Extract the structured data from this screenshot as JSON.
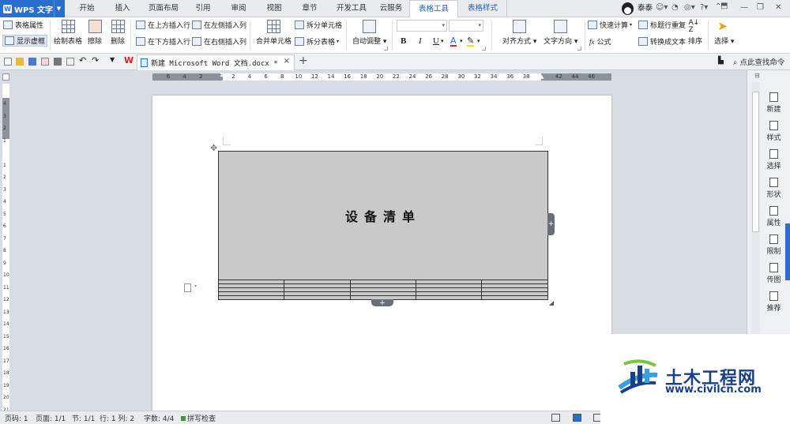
{
  "app": {
    "logo_text": "WPS 文字"
  },
  "menu_tabs": [
    "开始",
    "插入",
    "页面布局",
    "引用",
    "审阅",
    "视图",
    "章节",
    "开发工具",
    "云服务",
    "表格工具",
    "表格样式"
  ],
  "user": {
    "name": "泰泰"
  },
  "ribbon": {
    "table_props": "表格属性",
    "show_gridlines": "显示虚框",
    "draw_table": "绘制表格",
    "erase": "擦除",
    "delete": "删除",
    "insert_above": "在上方插入行",
    "insert_below": "在下方插入行",
    "insert_left": "在左侧插入列",
    "insert_right": "在右侧插入列",
    "merge_cells": "合并单元格",
    "split_cells": "拆分单元格",
    "split_table": "拆分表格",
    "autofit": "自动调整",
    "bold": "B",
    "italic": "I",
    "underline": "U",
    "font_color": "A",
    "align": "对齐方式",
    "text_dir": "文字方向",
    "quick_calc": "快速计算",
    "formula": "公式",
    "repeat_header": "标题行重复",
    "to_text": "转换成文本",
    "sort": "排序",
    "select": "选择"
  },
  "document_tab": {
    "title": "新建 Microsoft Word 文档.docx *"
  },
  "search": {
    "label": "点此查找命令"
  },
  "ruler": {
    "h_ticks": [
      "6",
      "4",
      "2",
      "",
      "2",
      "4",
      "6",
      "8",
      "10",
      "12",
      "14",
      "16",
      "18",
      "20",
      "22",
      "24",
      "26",
      "28",
      "30",
      "32",
      "34",
      "36",
      "38",
      "",
      "42",
      "44",
      "46"
    ],
    "v_ticks": [
      "4",
      "3",
      "2",
      "1",
      "",
      "1",
      "2",
      "3",
      "4",
      "5",
      "6",
      "7",
      "8",
      "9",
      "10",
      "11",
      "12",
      "13",
      "14",
      "15",
      "16",
      "17",
      "18",
      "19",
      "20",
      "21"
    ]
  },
  "table": {
    "title": "设备清单",
    "rows": 5,
    "cols": 5
  },
  "right_panel": [
    "新建",
    "样式",
    "选择",
    "形状",
    "属性",
    "限制",
    "传图",
    "推荐"
  ],
  "status": {
    "page_no": "页码: 1",
    "pages": "页面: 1/1",
    "section": "节: 1/1",
    "line_col": "行: 1  列: 2",
    "words": "字数: 4/4",
    "spell": "拼写检查"
  },
  "watermark": {
    "title": "土木工程网",
    "url": "www.civilcn.com"
  },
  "colors": {
    "accent": "#2b6fce",
    "table_fill": "#c9c9c9",
    "watermark": "#1a3e8a"
  }
}
